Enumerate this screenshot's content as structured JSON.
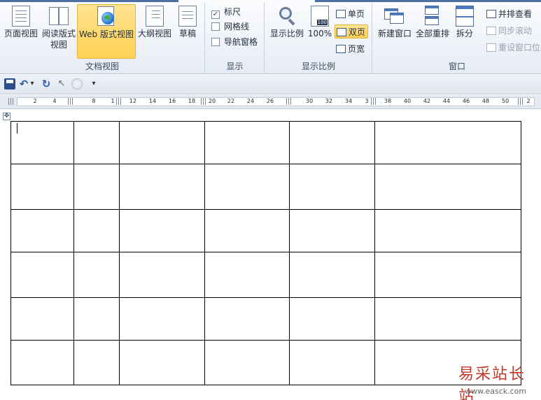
{
  "ribbon": {
    "views": {
      "group_label": "文档视图",
      "print_layout": "页面视图",
      "reading_l1": "阅读版式",
      "reading_l2": "视图",
      "web_layout": "Web 版式视图",
      "outline": "大纲视图",
      "draft": "草稿"
    },
    "show": {
      "group_label": "显示",
      "ruler": "标尺",
      "ruler_checked": true,
      "gridlines": "网格线",
      "gridlines_checked": false,
      "nav_pane": "导航窗格",
      "nav_pane_checked": false
    },
    "zoom": {
      "group_label": "显示比例",
      "zoom": "显示比例",
      "hundred": "100%",
      "hundred_badge": "100",
      "one_page": "单页",
      "two_pages": "双页",
      "page_width": "页宽"
    },
    "window": {
      "group_label": "窗口",
      "new_window": "新建窗口",
      "arrange_all": "全部重排",
      "split": "拆分",
      "side_by_side": "并排查看",
      "sync_scroll": "同步滚动",
      "reset_position": "重设窗口位"
    }
  },
  "qat": {
    "customize": "▾"
  },
  "ruler": {
    "labels": [
      "2",
      "4",
      "8",
      "1",
      "12",
      "14",
      "16",
      "18",
      "20",
      "22",
      "24",
      "26",
      "30",
      "32",
      "34",
      "3",
      "38",
      "40",
      "42",
      "44",
      "46",
      "48",
      "50",
      "2"
    ]
  },
  "table": {
    "rows": 6,
    "cols": 6
  },
  "watermark": {
    "title": "易采站长站",
    "url": "www.easck.com"
  }
}
